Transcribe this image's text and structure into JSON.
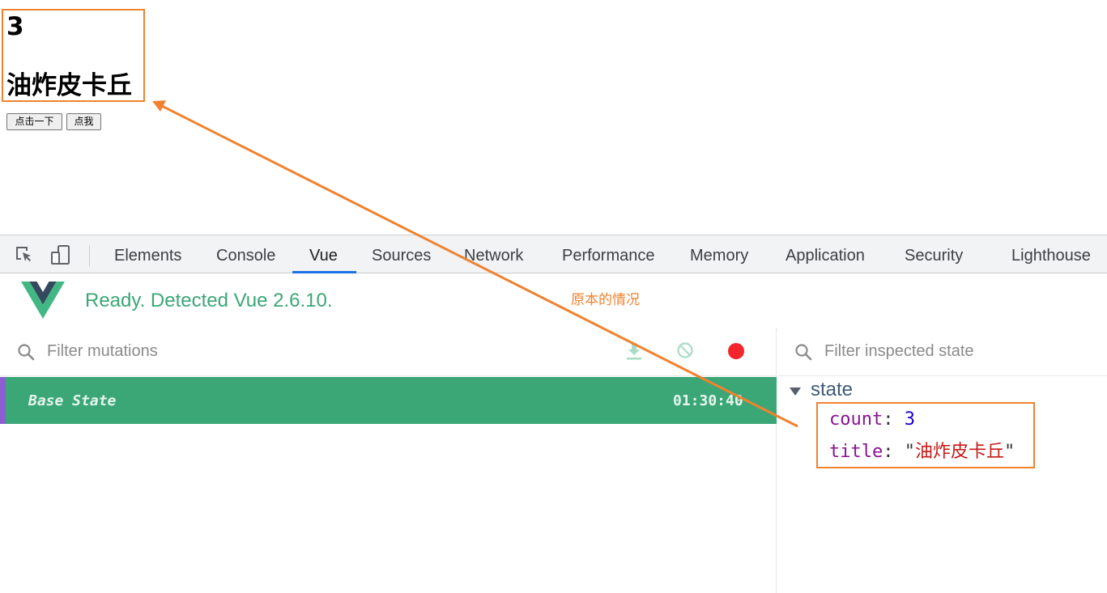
{
  "page": {
    "count": "3",
    "title": "油炸皮卡丘",
    "buttons": [
      "点击一下",
      "点我"
    ]
  },
  "devtools": {
    "tabs": [
      "Elements",
      "Console",
      "Vue",
      "Sources",
      "Network",
      "Performance",
      "Memory",
      "Application",
      "Security",
      "Lighthouse"
    ],
    "active_tab": "Vue",
    "icons": [
      "inspect-element-icon",
      "device-toggle-icon"
    ]
  },
  "vue": {
    "ready_text": "Ready. Detected Vue 2.6.10.",
    "annotation": "原本的情况",
    "logo": "vue-logo",
    "accent": "#3ca776"
  },
  "mutations": {
    "filter_placeholder": "Filter mutations",
    "rows": [
      {
        "label": "Base State",
        "time": "01:30:40"
      }
    ],
    "icons": [
      "download-icon",
      "clear-icon",
      "record-icon"
    ]
  },
  "inspector": {
    "filter_placeholder": "Filter inspected state",
    "section": "state",
    "props": [
      {
        "key": "count",
        "value": "3",
        "type": "number"
      },
      {
        "key": "title",
        "value": "油炸皮卡丘",
        "type": "string"
      }
    ]
  },
  "colors": {
    "annotation": "#f0822f",
    "active_tab_underline": "#1a73e8",
    "record": "#f2242c"
  }
}
